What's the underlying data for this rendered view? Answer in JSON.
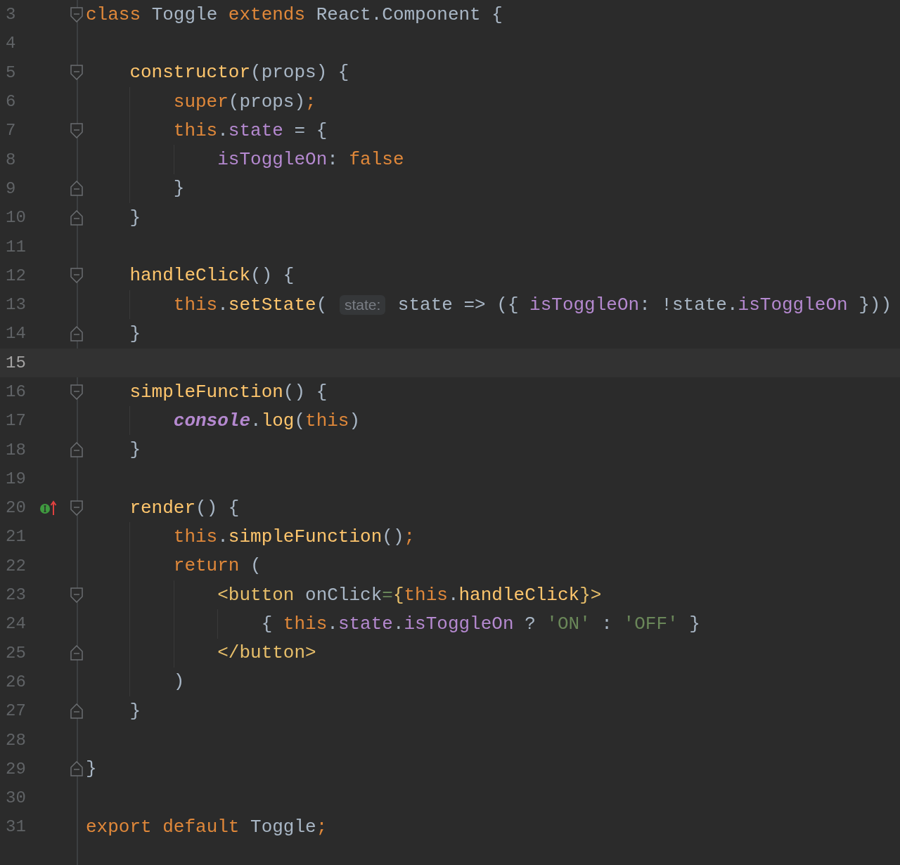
{
  "editor": {
    "lines": [
      {
        "number": "3",
        "current": false,
        "fold": {
          "kind": "start"
        },
        "tokens": [
          {
            "kind": "keyword",
            "text": "class "
          },
          {
            "kind": "plain",
            "text": "Toggle "
          },
          {
            "kind": "keyword",
            "text": "extends "
          },
          {
            "kind": "plain",
            "text": "React.Component {"
          }
        ]
      },
      {
        "number": "4",
        "current": false
      },
      {
        "number": "5",
        "current": false,
        "fold": {
          "kind": "start"
        },
        "tokens": [
          {
            "kind": "function",
            "text": "    constructor"
          },
          {
            "kind": "plain",
            "text": "(props) {"
          }
        ]
      },
      {
        "number": "6",
        "current": false,
        "tokens": [
          {
            "kind": "keyword",
            "text": "        super"
          },
          {
            "kind": "plain",
            "text": "(props)"
          },
          {
            "kind": "keyword",
            "text": ";"
          }
        ]
      },
      {
        "number": "7",
        "current": false,
        "fold": {
          "kind": "start"
        },
        "tokens": [
          {
            "kind": "keyword",
            "text": "        this"
          },
          {
            "kind": "plain",
            "text": "."
          },
          {
            "kind": "property",
            "text": "state"
          },
          {
            "kind": "plain",
            "text": " = {"
          }
        ]
      },
      {
        "number": "8",
        "current": false,
        "tokens": [
          {
            "kind": "property",
            "text": "            isToggleOn"
          },
          {
            "kind": "plain",
            "text": ": "
          },
          {
            "kind": "keyword",
            "text": "false"
          }
        ]
      },
      {
        "number": "9",
        "current": false,
        "fold": {
          "kind": "end"
        },
        "tokens": [
          {
            "kind": "plain",
            "text": "        }"
          }
        ]
      },
      {
        "number": "10",
        "current": false,
        "fold": {
          "kind": "end"
        },
        "tokens": [
          {
            "kind": "plain",
            "text": "    }"
          }
        ]
      },
      {
        "number": "11",
        "current": false
      },
      {
        "number": "12",
        "current": false,
        "fold": {
          "kind": "start"
        },
        "tokens": [
          {
            "kind": "function",
            "text": "    handleClick"
          },
          {
            "kind": "plain",
            "text": "() {"
          }
        ]
      },
      {
        "number": "13",
        "current": false,
        "tokens": [
          {
            "kind": "keyword",
            "text": "        this"
          },
          {
            "kind": "plain",
            "text": "."
          },
          {
            "kind": "function",
            "text": "setState"
          },
          {
            "kind": "plain",
            "text": "( "
          },
          {
            "kind": "hint",
            "text": "state:"
          },
          {
            "kind": "plain",
            "text": " state => ({ "
          },
          {
            "kind": "property",
            "text": "isToggleOn"
          },
          {
            "kind": "plain",
            "text": ": !state."
          },
          {
            "kind": "property",
            "text": "isToggleOn"
          },
          {
            "kind": "plain",
            "text": " }))"
          }
        ]
      },
      {
        "number": "14",
        "current": false,
        "fold": {
          "kind": "end"
        },
        "tokens": [
          {
            "kind": "plain",
            "text": "    }"
          }
        ]
      },
      {
        "number": "15",
        "current": true
      },
      {
        "number": "16",
        "current": false,
        "fold": {
          "kind": "start"
        },
        "tokens": [
          {
            "kind": "function",
            "text": "    simpleFunction"
          },
          {
            "kind": "plain",
            "text": "() {"
          }
        ]
      },
      {
        "number": "17",
        "current": false,
        "tokens": [
          {
            "kind": "static",
            "text": "        console"
          },
          {
            "kind": "plain",
            "text": "."
          },
          {
            "kind": "function",
            "text": "log"
          },
          {
            "kind": "plain",
            "text": "("
          },
          {
            "kind": "keyword",
            "text": "this"
          },
          {
            "kind": "plain",
            "text": ")"
          }
        ]
      },
      {
        "number": "18",
        "current": false,
        "fold": {
          "kind": "end"
        },
        "tokens": [
          {
            "kind": "plain",
            "text": "    }"
          }
        ]
      },
      {
        "number": "19",
        "current": false
      },
      {
        "number": "20",
        "current": false,
        "fold": {
          "kind": "start"
        },
        "gutter_icon": {
          "kind": "override"
        },
        "tokens": [
          {
            "kind": "function",
            "text": "    render"
          },
          {
            "kind": "plain",
            "text": "() {"
          }
        ]
      },
      {
        "number": "21",
        "current": false,
        "tokens": [
          {
            "kind": "keyword",
            "text": "        this"
          },
          {
            "kind": "plain",
            "text": "."
          },
          {
            "kind": "function",
            "text": "simpleFunction"
          },
          {
            "kind": "plain",
            "text": "()"
          },
          {
            "kind": "keyword",
            "text": ";"
          }
        ]
      },
      {
        "number": "22",
        "current": false,
        "tokens": [
          {
            "kind": "keyword",
            "text": "        return "
          },
          {
            "kind": "plain",
            "text": "("
          }
        ]
      },
      {
        "number": "23",
        "current": false,
        "fold": {
          "kind": "start"
        },
        "tokens": [
          {
            "kind": "tag",
            "text": "            <button "
          },
          {
            "kind": "plain",
            "text": "onClick"
          },
          {
            "kind": "string",
            "text": "="
          },
          {
            "kind": "tag",
            "text": "{"
          },
          {
            "kind": "keyword",
            "text": "this"
          },
          {
            "kind": "plain",
            "text": "."
          },
          {
            "kind": "function",
            "text": "handleClick"
          },
          {
            "kind": "tag",
            "text": "}>"
          }
        ]
      },
      {
        "number": "24",
        "current": false,
        "tokens": [
          {
            "kind": "plain",
            "text": "                { "
          },
          {
            "kind": "keyword",
            "text": "this"
          },
          {
            "kind": "plain",
            "text": "."
          },
          {
            "kind": "property",
            "text": "state"
          },
          {
            "kind": "plain",
            "text": "."
          },
          {
            "kind": "property",
            "text": "isToggleOn"
          },
          {
            "kind": "plain",
            "text": " ? "
          },
          {
            "kind": "string",
            "text": "'ON'"
          },
          {
            "kind": "plain",
            "text": " : "
          },
          {
            "kind": "string",
            "text": "'OFF'"
          },
          {
            "kind": "plain",
            "text": " }"
          }
        ]
      },
      {
        "number": "25",
        "current": false,
        "fold": {
          "kind": "end"
        },
        "tokens": [
          {
            "kind": "tag",
            "text": "            </button>"
          }
        ]
      },
      {
        "number": "26",
        "current": false,
        "tokens": [
          {
            "kind": "plain",
            "text": "        )"
          }
        ]
      },
      {
        "number": "27",
        "current": false,
        "fold": {
          "kind": "end"
        },
        "tokens": [
          {
            "kind": "plain",
            "text": "    }"
          }
        ]
      },
      {
        "number": "28",
        "current": false
      },
      {
        "number": "29",
        "current": false,
        "fold": {
          "kind": "end"
        },
        "tokens": [
          {
            "kind": "plain",
            "text": "}"
          }
        ]
      },
      {
        "number": "30",
        "current": false
      },
      {
        "number": "31",
        "current": false,
        "tokens": [
          {
            "kind": "keyword",
            "text": "export default "
          },
          {
            "kind": "plain",
            "text": "Toggle"
          },
          {
            "kind": "keyword",
            "text": ";"
          }
        ]
      }
    ]
  }
}
